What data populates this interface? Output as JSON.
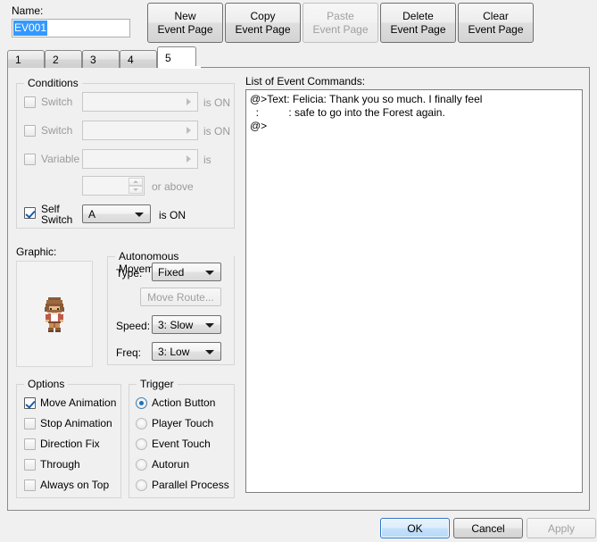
{
  "name_field": {
    "label": "Name:",
    "value": "EV001",
    "selected": true
  },
  "page_buttons": [
    {
      "label": "New\nEvent Page",
      "enabled": true
    },
    {
      "label": "Copy\nEvent Page",
      "enabled": true
    },
    {
      "label": "Paste\nEvent Page",
      "enabled": false
    },
    {
      "label": "Delete\nEvent Page",
      "enabled": true
    },
    {
      "label": "Clear\nEvent Page",
      "enabled": true
    }
  ],
  "tabs": {
    "items": [
      "1",
      "2",
      "3",
      "4",
      "5"
    ],
    "active": "5"
  },
  "conditions": {
    "title": "Conditions",
    "rows": [
      {
        "label": "Switch",
        "checked": false,
        "value": "",
        "suffix": "is ON"
      },
      {
        "label": "Switch",
        "checked": false,
        "value": "",
        "suffix": "is ON"
      },
      {
        "label": "Variable",
        "checked": false,
        "value": "",
        "suffix": "is"
      }
    ],
    "variable_value": "",
    "variable_suffix": "or above",
    "self_switch": {
      "label": "Self\nSwitch",
      "checked": true,
      "value": "A",
      "suffix": "is ON"
    }
  },
  "graphic": {
    "label": "Graphic:"
  },
  "autonomous_movement": {
    "title": "Autonomous Movement",
    "type_label": "Type:",
    "type_value": "Fixed",
    "move_route_button": "Move Route...",
    "move_route_enabled": false,
    "speed_label": "Speed:",
    "speed_value": "3: Slow",
    "freq_label": "Freq:",
    "freq_value": "3: Low"
  },
  "options": {
    "title": "Options",
    "items": [
      {
        "label": "Move Animation",
        "checked": true
      },
      {
        "label": "Stop Animation",
        "checked": false
      },
      {
        "label": "Direction Fix",
        "checked": false
      },
      {
        "label": "Through",
        "checked": false
      },
      {
        "label": "Always on Top",
        "checked": false
      }
    ]
  },
  "trigger": {
    "title": "Trigger",
    "items": [
      {
        "label": "Action Button",
        "selected": true
      },
      {
        "label": "Player Touch",
        "selected": false
      },
      {
        "label": "Event Touch",
        "selected": false
      },
      {
        "label": "Autorun",
        "selected": false
      },
      {
        "label": "Parallel Process",
        "selected": false
      }
    ]
  },
  "event_commands": {
    "label": "List of Event Commands:",
    "text": "@>Text: Felicia: Thank you so much. I finally feel\n  :          : safe to go into the Forest again.\n@>"
  },
  "dialog_buttons": [
    {
      "label": "OK",
      "enabled": true,
      "default": true
    },
    {
      "label": "Cancel",
      "enabled": true,
      "default": false
    },
    {
      "label": "Apply",
      "enabled": false,
      "default": false
    }
  ],
  "colors": {
    "window_bg": "#f0f0f0",
    "selection_blue": "#3399ff",
    "accent_blue": "#1f6fb5",
    "disabled_text": "#a0a0a0"
  }
}
